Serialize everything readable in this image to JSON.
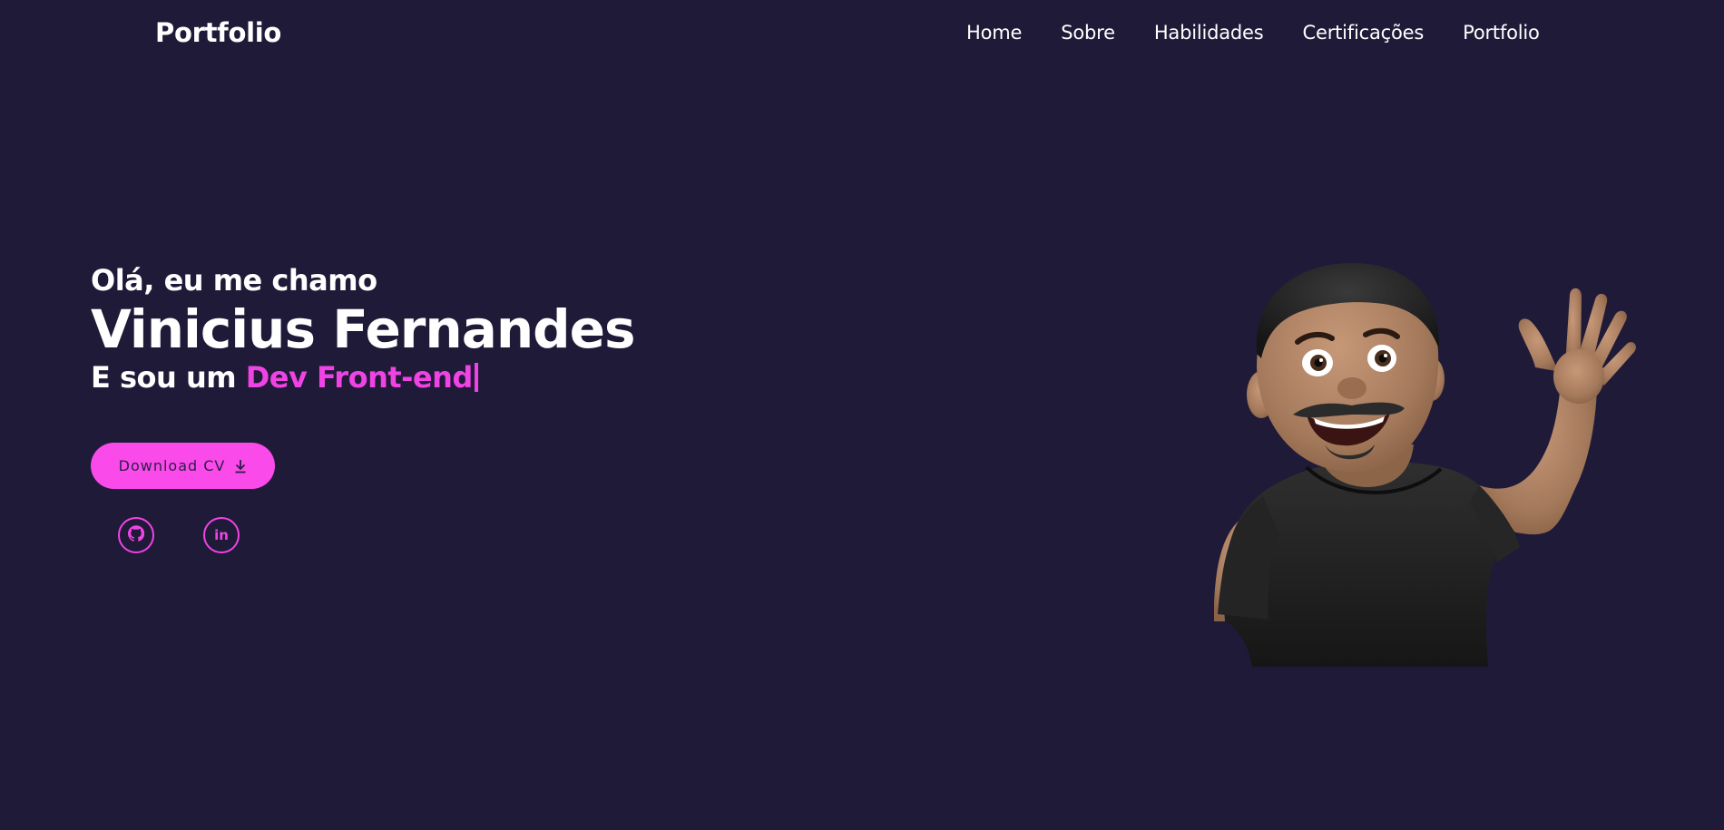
{
  "header": {
    "logo": "Portfolio",
    "nav": [
      {
        "label": "Home"
      },
      {
        "label": "Sobre"
      },
      {
        "label": "Habilidades"
      },
      {
        "label": "Certificações"
      },
      {
        "label": "Portfolio"
      }
    ]
  },
  "hero": {
    "greeting": "Olá, eu me chamo",
    "name": "Vinicius Fernandes",
    "role_prefix": "E sou um ",
    "role_accent": "Dev Front-end",
    "cv_button": "Download CV"
  },
  "socials": {
    "github_label": "github",
    "linkedin_label": "in"
  },
  "colors": {
    "background": "#1f1a38",
    "accent": "#f043e4",
    "button": "#fa4ae9",
    "text": "#ffffff"
  },
  "icons": {
    "download": "download-icon",
    "github": "github-icon",
    "linkedin": "linkedin-icon"
  }
}
